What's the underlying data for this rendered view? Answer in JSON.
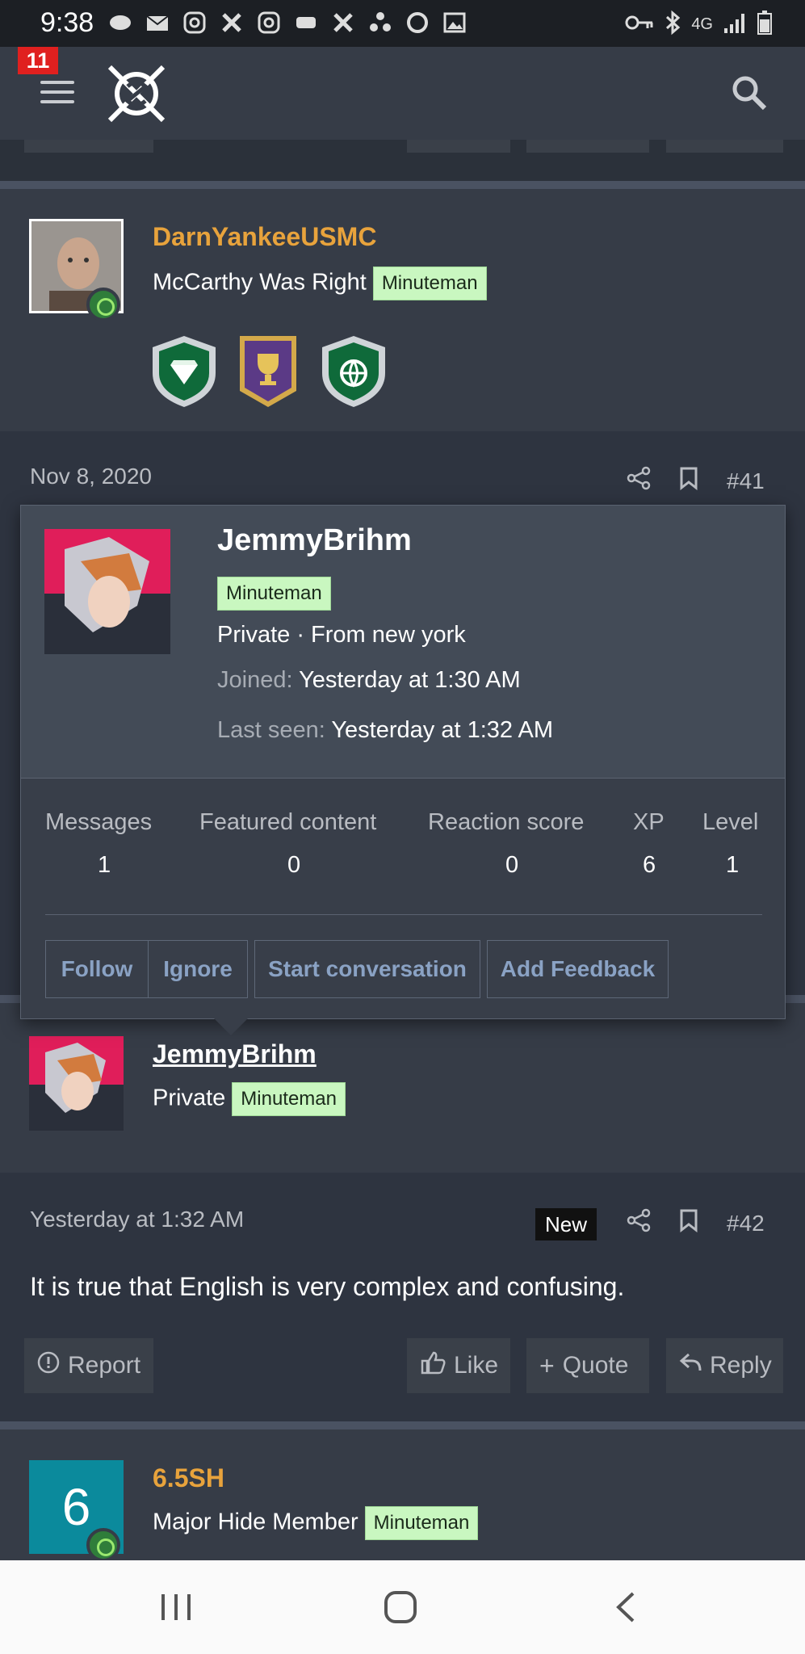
{
  "status_bar": {
    "time": "9:38",
    "network": "4G"
  },
  "header": {
    "notification_count": "11"
  },
  "posts": [
    {
      "username": "DarnYankeeUSMC",
      "user_title": "McCarthy Was Right",
      "tag": "Minuteman",
      "trophies": [
        "diamond-shield-icon",
        "trophy-shield-icon",
        "globe-shield-icon"
      ],
      "date": "Nov 8, 2020",
      "number": "#41"
    },
    {
      "username": "JemmyBrihm",
      "user_title": "Private",
      "tag": "Minuteman",
      "date": "Yesterday at 1:32 AM",
      "new_label": "New",
      "number": "#42",
      "text": "It is true that English is very complex and confusing.",
      "actions": {
        "report": "Report",
        "like": "Like",
        "quote": "Quote",
        "reply": "Reply"
      }
    },
    {
      "username": "6.5SH",
      "user_title": "Major Hide Member",
      "tag": "Minuteman",
      "avatar_letter": "6"
    }
  ],
  "popup": {
    "name": "JemmyBrihm",
    "tag": "Minuteman",
    "subtitle": "Private · From new york",
    "joined_label": "Joined:",
    "joined_value": "Yesterday at 1:30 AM",
    "last_seen_label": "Last seen:",
    "last_seen_value": "Yesterday at 1:32 AM",
    "stats": [
      {
        "label": "Messages",
        "value": "1"
      },
      {
        "label": "Featured content",
        "value": "0"
      },
      {
        "label": "Reaction score",
        "value": "0"
      },
      {
        "label": "XP",
        "value": "6"
      },
      {
        "label": "Level",
        "value": "1"
      }
    ],
    "buttons": {
      "follow": "Follow",
      "ignore": "Ignore",
      "start_conversation": "Start conversation",
      "add_feedback": "Add Feedback"
    }
  },
  "colors": {
    "accent_username": "#e8a33c",
    "tag_bg": "#c9f7c0",
    "link_button": "#8aa2c4"
  }
}
